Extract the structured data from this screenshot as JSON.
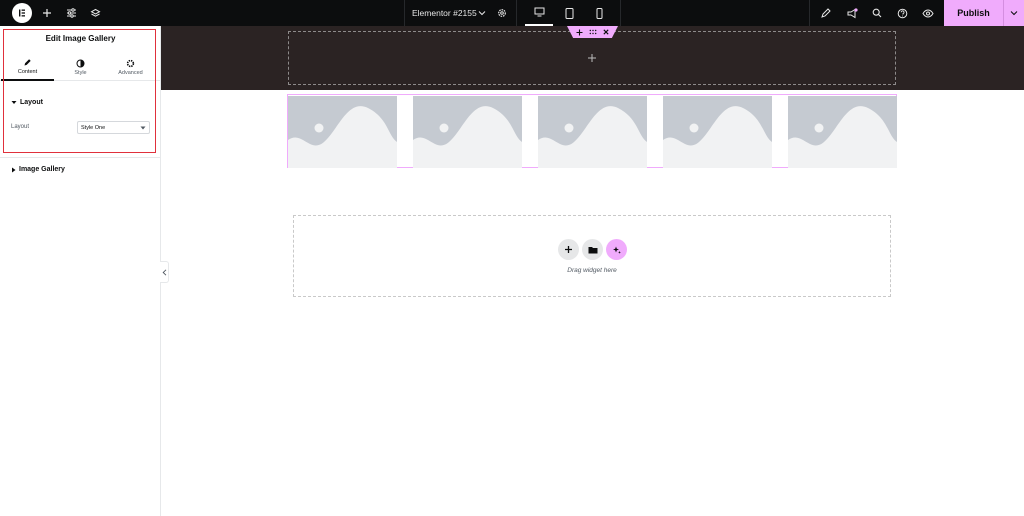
{
  "topbar": {
    "document_title": "Elementor #2155",
    "publish_label": "Publish",
    "left_icons": [
      "elementor-logo-icon",
      "add-icon",
      "settings-sliders-icon",
      "layers-icon"
    ],
    "devices": [
      "desktop-icon",
      "tablet-icon",
      "mobile-icon"
    ],
    "right_icons": [
      "notes-icon",
      "whats-new-icon",
      "search-icon",
      "help-icon",
      "preview-icon"
    ]
  },
  "panel": {
    "title": "Edit Image Gallery",
    "tabs": [
      {
        "label": "Content",
        "icon": "pencil-icon",
        "active": true
      },
      {
        "label": "Style",
        "icon": "contrast-icon",
        "active": false
      },
      {
        "label": "Advanced",
        "icon": "gear-icon",
        "active": false
      }
    ],
    "sections": {
      "layout": {
        "title": "Layout",
        "field_label": "Layout",
        "select_value": "Style One"
      },
      "image_gallery": {
        "title": "Image Gallery"
      }
    }
  },
  "canvas": {
    "gallery_image_count": 5,
    "drop_zone_text": "Drag widget here"
  },
  "colors": {
    "accent": "#f0abfc",
    "topbar": "#0c0d0e",
    "dark_section": "#2b2323",
    "highlight": "#e0303b"
  }
}
